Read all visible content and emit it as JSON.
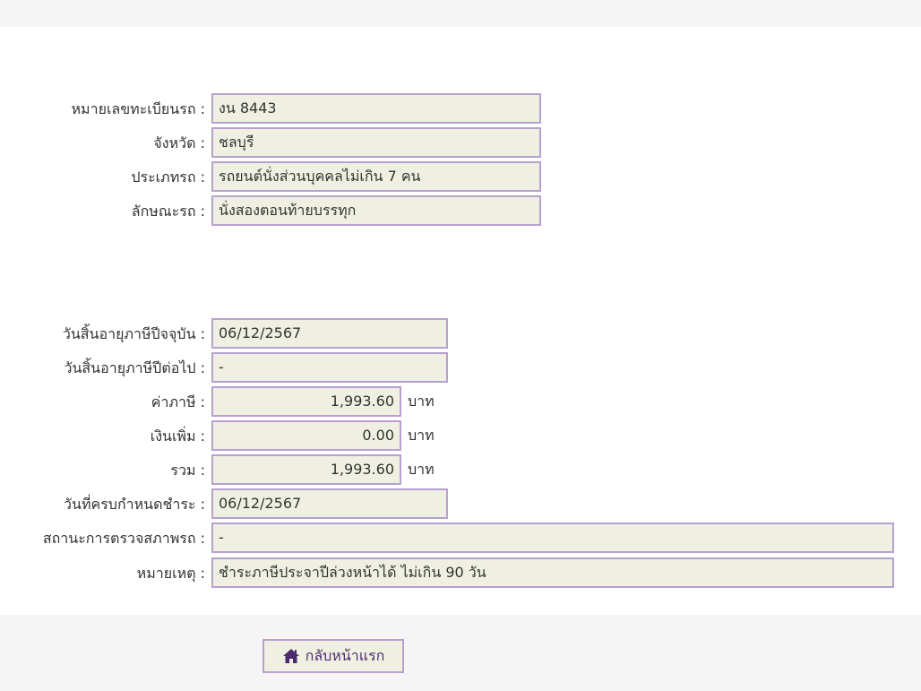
{
  "vehicle": {
    "plate_label": "หมายเลขทะเบียนรถ :",
    "plate_value": "งน 8443",
    "province_label": "จังหวัด :",
    "province_value": "ชลบุรี",
    "type_label": "ประเภทรถ :",
    "type_value": "รถยนต์นั่งส่วนบุคคลไม่เกิน 7 คน",
    "style_label": "ลักษณะรถ :",
    "style_value": "นั่งสองตอนท้ายบรรทุก"
  },
  "tax": {
    "expiry_current_label": "วันสิ้นอายุภาษีปีจจุบัน :",
    "expiry_current_value": "06/12/2567",
    "expiry_next_label": "วันสิ้นอายุภาษีปีต่อไป :",
    "expiry_next_value": "-",
    "tax_amount_label": "ค่าภาษี :",
    "tax_amount_value": "1,993.60",
    "surcharge_label": "เงินเพิ่ม :",
    "surcharge_value": "0.00",
    "total_label": "รวม :",
    "total_value": "1,993.60",
    "currency_unit": "บาท",
    "due_date_label": "วันที่ครบกำหนดชำระ :",
    "due_date_value": "06/12/2567",
    "inspection_label": "สถานะการตรวจสภาพรถ :",
    "inspection_value": "-",
    "remark_label": "หมายเหตุ :",
    "remark_value": "ชำระภาษีประจาปีล่วงหน้าได้ ไม่เกิน 90 วัน"
  },
  "footer": {
    "home_button_label": "กลับหน้าแรก",
    "home_icon": "home-icon"
  },
  "colors": {
    "field_border": "#b8a0d0",
    "field_background": "#f0f0e2",
    "button_text": "#4b2c6e",
    "bar_background": "#f5f5f5"
  }
}
